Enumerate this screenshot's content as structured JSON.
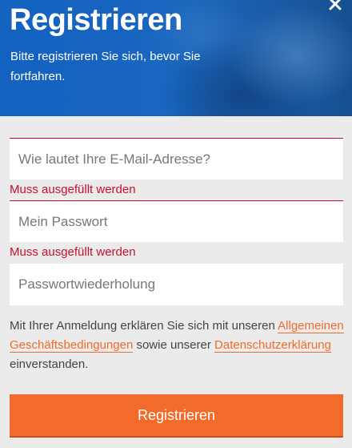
{
  "header": {
    "title": "Registrieren",
    "subtitle": "Bitte registrieren Sie sich, bevor Sie fortfahren.",
    "close_icon": "close-icon"
  },
  "form": {
    "email": {
      "placeholder": "Wie lautet Ihre E-Mail-Adresse?",
      "value": "",
      "error": "Muss ausgefüllt werden"
    },
    "password": {
      "placeholder": "Mein Passwort",
      "value": "",
      "error": "Muss ausgefüllt werden"
    },
    "password_repeat": {
      "placeholder": "Passwortwiederholung",
      "value": ""
    }
  },
  "terms": {
    "text_before": "Mit Ihrer Anmeldung erklären Sie sich mit unseren ",
    "agb_link": "Allgemeinen Geschäftsbedingungen",
    "text_middle": " sowie unserer ",
    "privacy_link": "Datenschutzerklärung",
    "text_after": " einverstanden."
  },
  "submit_label": "Registrieren",
  "colors": {
    "accent": "#f26b2a",
    "error": "#c8102e",
    "header_blue": "#1a67bd",
    "background": "#ebebeb"
  }
}
